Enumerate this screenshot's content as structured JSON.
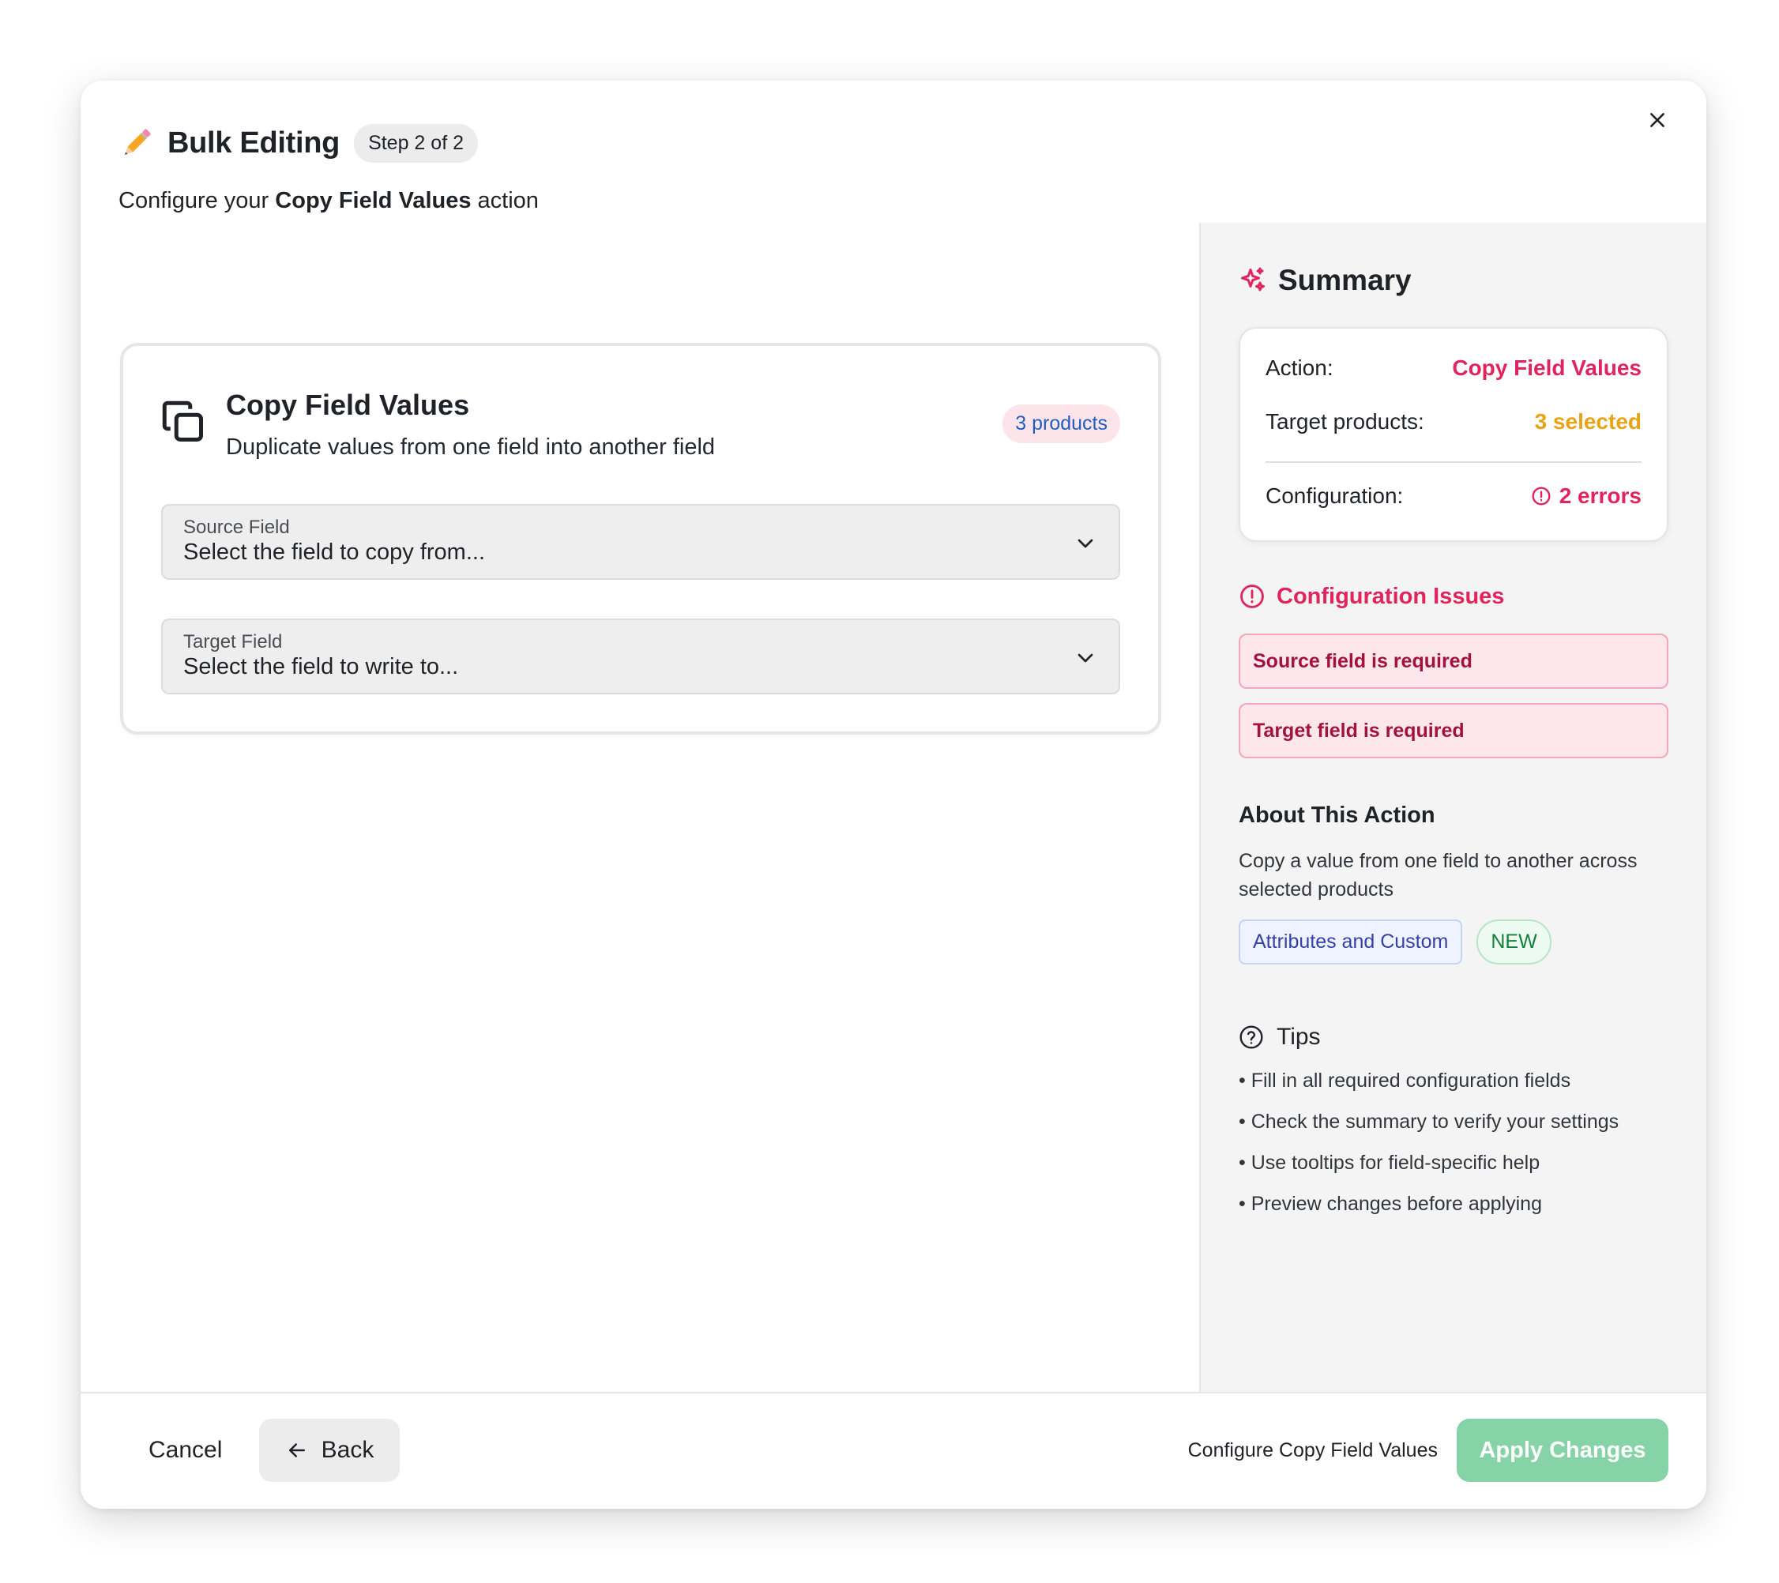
{
  "dialog": {
    "title": "Bulk Editing",
    "step_badge": "Step 2 of 2",
    "subtitle_prefix": "Configure your ",
    "subtitle_action": "Copy Field Values",
    "subtitle_suffix": " action",
    "close_icon": "close-icon"
  },
  "action_card": {
    "icon": "copy-icon",
    "title": "Copy Field Values",
    "description": "Duplicate values from one field into another field",
    "products_badge": "3 products",
    "source_field": {
      "label": "Source Field",
      "placeholder": "Select the field to copy from..."
    },
    "target_field": {
      "label": "Target Field",
      "placeholder": "Select the field to write to..."
    }
  },
  "summary": {
    "title": "Summary",
    "rows": [
      {
        "label": "Action:",
        "value": "Copy Field Values"
      },
      {
        "label": "Target products:",
        "value": "3 selected"
      },
      {
        "label": "Configuration:",
        "value": "2 errors"
      }
    ]
  },
  "issues": {
    "title": "Configuration Issues",
    "items": [
      "Source field is required",
      "Target field is required"
    ]
  },
  "about": {
    "title": "About This Action",
    "description": "Copy a value from one field to another across selected products",
    "tags": [
      "Attributes and Custom",
      "NEW"
    ]
  },
  "tips": {
    "title": "Tips",
    "items": [
      "Fill in all required configuration fields",
      "Check the summary to verify your settings",
      "Use tooltips for field-specific help",
      "Preview changes before applying"
    ]
  },
  "footer": {
    "cancel": "Cancel",
    "back": "Back",
    "hint": "Configure Copy Field Values",
    "apply": "Apply Changes"
  },
  "colors": {
    "accent_pink": "#e0245e",
    "accent_orange": "#e8a317",
    "apply_disabled": "#86d3a7"
  }
}
